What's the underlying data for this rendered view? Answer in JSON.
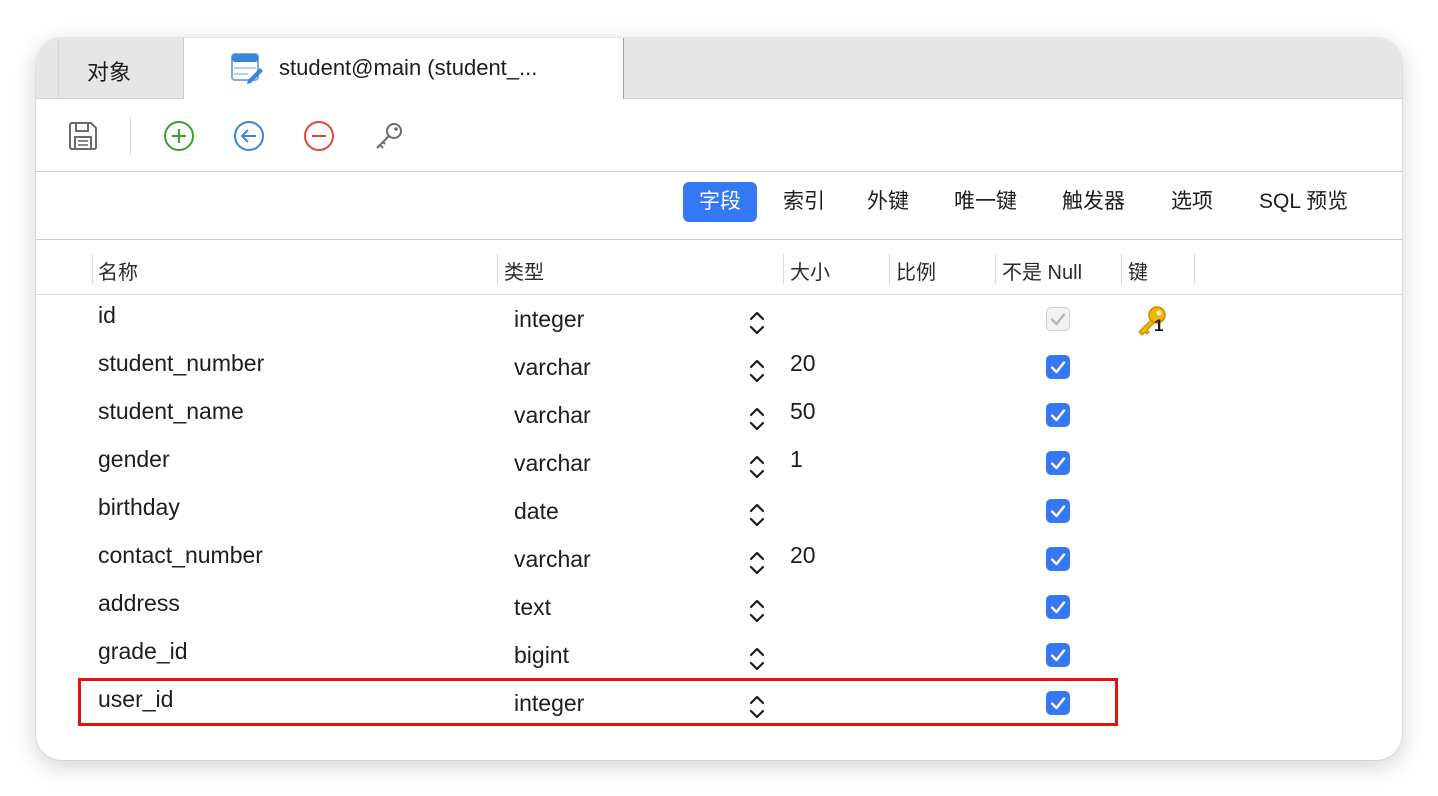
{
  "tabs": {
    "objects_label": "对象",
    "table_label": "student@main (student_..."
  },
  "toolbar": {
    "save": "save-icon",
    "add": "add-field-icon",
    "insert": "insert-field-icon",
    "delete": "delete-field-icon",
    "primary_key": "primary-key-icon"
  },
  "subtabs": {
    "fields": "字段",
    "indexes": "索引",
    "foreign_keys": "外键",
    "unique_keys": "唯一键",
    "triggers": "触发器",
    "options": "选项",
    "sql_preview": "SQL 预览"
  },
  "columns": {
    "name": "名称",
    "type": "类型",
    "size": "大小",
    "scale": "比例",
    "not_null": "不是 Null",
    "key": "键"
  },
  "rows": [
    {
      "name": "id",
      "type": "integer",
      "size": "",
      "not_null": true,
      "not_null_disabled": true,
      "key": "1"
    },
    {
      "name": "student_number",
      "type": "varchar",
      "size": "20",
      "not_null": true
    },
    {
      "name": "student_name",
      "type": "varchar",
      "size": "50",
      "not_null": true
    },
    {
      "name": "gender",
      "type": "varchar",
      "size": "1",
      "not_null": true
    },
    {
      "name": "birthday",
      "type": "date",
      "size": "",
      "not_null": true
    },
    {
      "name": "contact_number",
      "type": "varchar",
      "size": "20",
      "not_null": true
    },
    {
      "name": "address",
      "type": "text",
      "size": "",
      "not_null": true
    },
    {
      "name": "grade_id",
      "type": "bigint",
      "size": "",
      "not_null": true
    },
    {
      "name": "user_id",
      "type": "integer",
      "size": "",
      "not_null": true
    }
  ],
  "colors": {
    "accent": "#3478f6",
    "highlight": "#e3120b",
    "add": "#3aa12f",
    "insert": "#3a86d8",
    "delete": "#d84a3a"
  }
}
